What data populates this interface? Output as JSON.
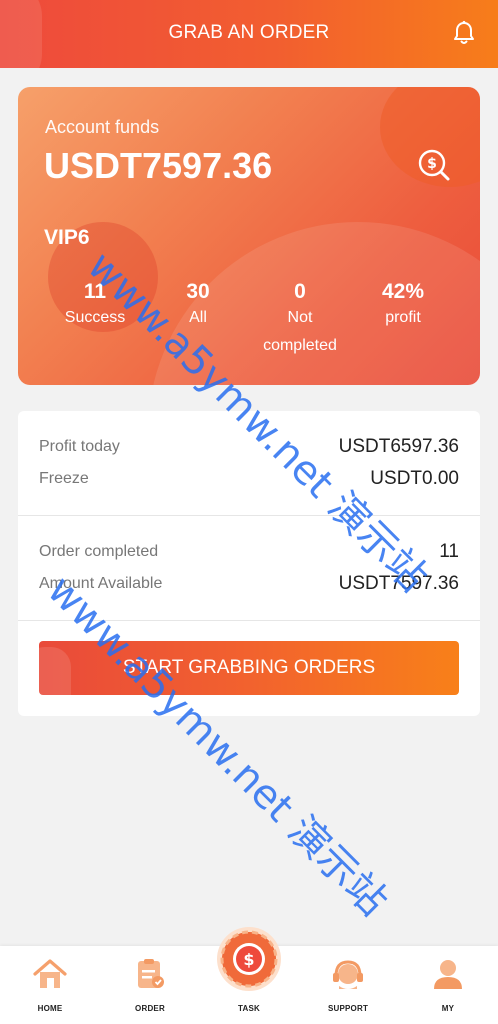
{
  "header": {
    "title": "GRAB AN ORDER",
    "bell_icon": "bell-icon"
  },
  "funds_card": {
    "label": "Account funds",
    "value": "USDT7597.36",
    "vip": "VIP6",
    "icon": "dollar-search-icon",
    "stats": [
      {
        "num": "11",
        "label": "Success"
      },
      {
        "num": "30",
        "label": "All"
      },
      {
        "num": "0",
        "label": "Not completed"
      },
      {
        "num": "42%",
        "label": "profit"
      }
    ]
  },
  "details": {
    "profit_today_label": "Profit today",
    "profit_today_value": "USDT6597.36",
    "freeze_label": "Freeze",
    "freeze_value": "USDT0.00",
    "order_completed_label": "Order completed",
    "order_completed_value": "11",
    "amount_available_label": "Amount Available",
    "amount_available_value": "USDT7597.36",
    "start_button": "START GRABBING ORDERS"
  },
  "watermark": "www.a5ymw.net 演示站",
  "nav": {
    "items": [
      {
        "label": "HOME",
        "icon": "home-icon"
      },
      {
        "label": "ORDER",
        "icon": "order-icon"
      },
      {
        "label": "TASK",
        "icon": "task-dollar-icon"
      },
      {
        "label": "SUPPORT",
        "icon": "support-icon"
      },
      {
        "label": "MY",
        "icon": "user-icon"
      }
    ]
  },
  "colors": {
    "accent": "#ee4a3c",
    "accent_end": "#f77d1a",
    "watermark": "#2d6ef0"
  }
}
